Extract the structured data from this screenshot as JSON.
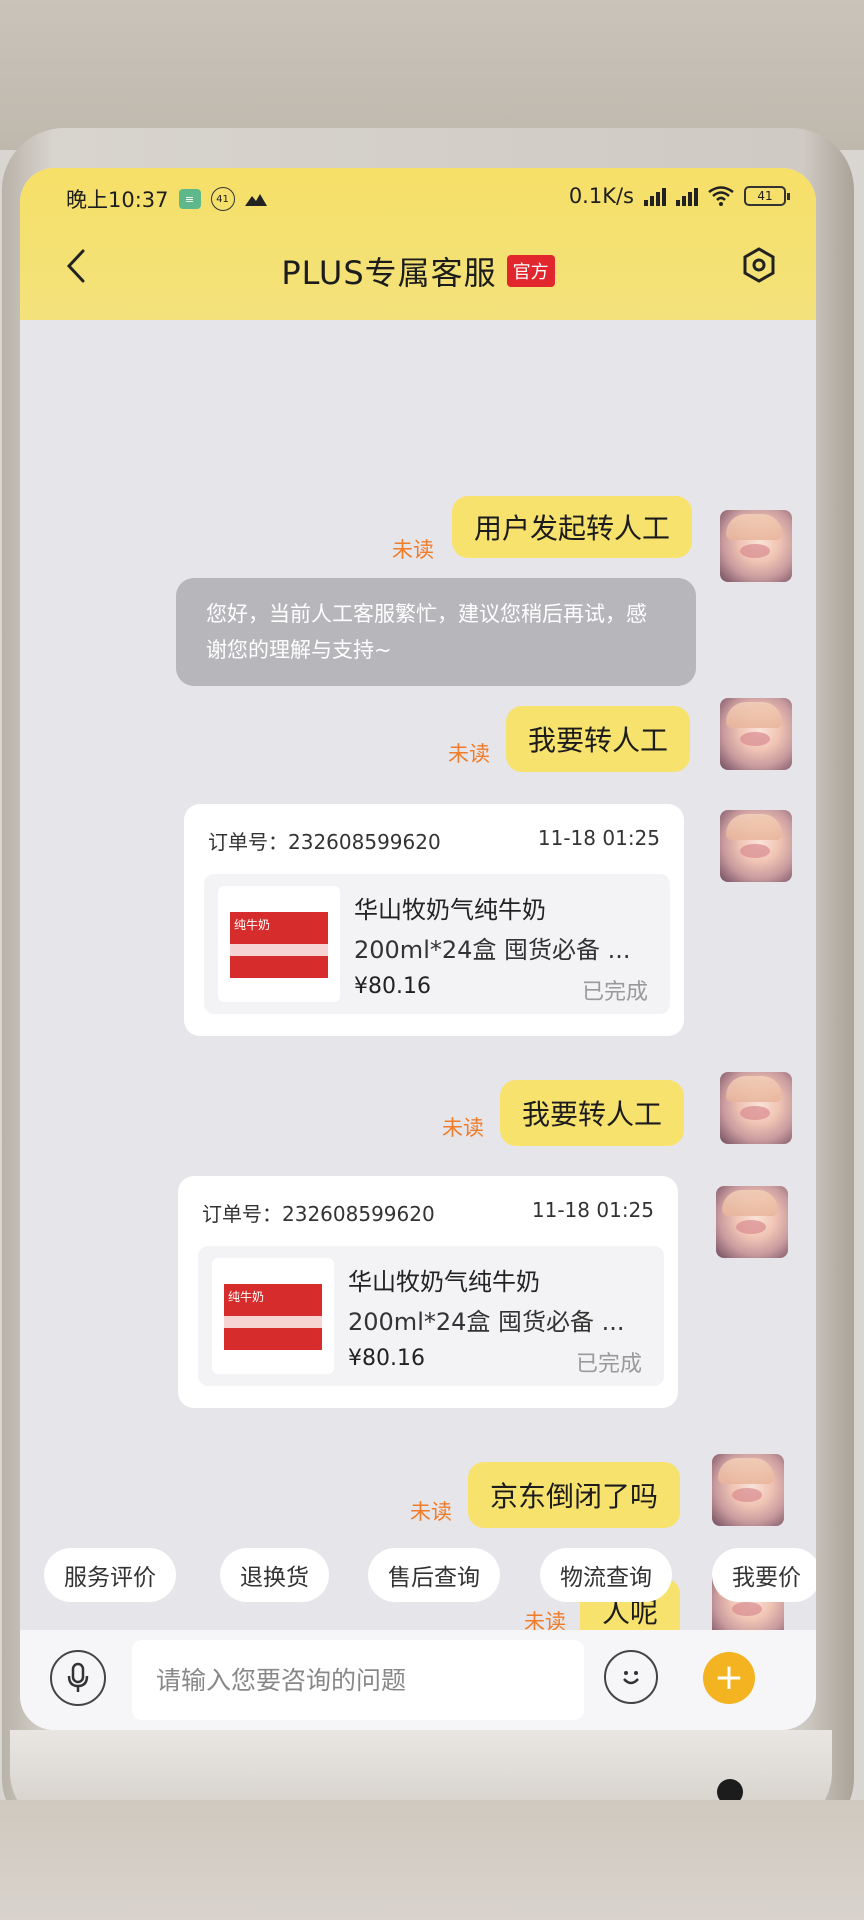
{
  "status_bar": {
    "time": "晚上10:37",
    "sim_badge": "​",
    "notif_count": "41",
    "network_speed": "0.1K/s",
    "battery": "41"
  },
  "header": {
    "title": "PLUS专属客服",
    "official_badge": "官方",
    "back_icon": "chevron-left-icon",
    "settings_icon": "settings-hexagon-icon"
  },
  "messages": {
    "m1": {
      "text": "用户发起转人工",
      "status": "未读"
    },
    "system": {
      "text": "您好，当前人工客服繁忙，建议您稍后再试，感谢您的理解与支持~"
    },
    "m2": {
      "text": "我要转人工",
      "status": "未读"
    },
    "m3": {
      "text": "我要转人工",
      "status": "未读"
    },
    "m4": {
      "text": "京东倒闭了吗",
      "status": "未读"
    },
    "m5": {
      "text": "人呢",
      "status": "未读"
    }
  },
  "order_cards": [
    {
      "order_no": "订单号：232608599620",
      "time": "11-18 01:25",
      "product_name": "华山牧奶气纯牛奶",
      "product_desc": "200ml*24盒  囤货必备 ...",
      "price": "¥80.16",
      "status": "已完成"
    },
    {
      "order_no": "订单号：232608599620",
      "time": "11-18 01:25",
      "product_name": "华山牧奶气纯牛奶",
      "product_desc": "200ml*24盒  囤货必备 ...",
      "price": "¥80.16",
      "status": "已完成"
    }
  ],
  "quick_actions": [
    "服务评价",
    "退换货",
    "售后查询",
    "物流查询",
    "我要价"
  ],
  "input": {
    "placeholder": "请输入您要咨询的问题",
    "value": ""
  },
  "colors": {
    "header_yellow": "#f6e068",
    "bubble_yellow": "#f7e26d",
    "unread_orange": "#f07c2a",
    "official_red": "#e2262d",
    "plus_orange": "#f4b321"
  }
}
